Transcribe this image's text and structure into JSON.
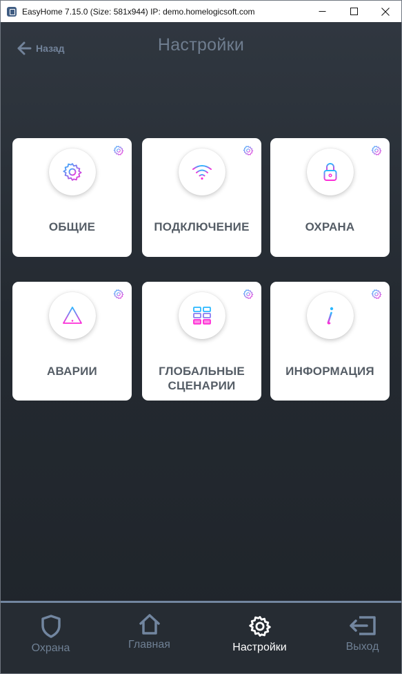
{
  "window": {
    "title": "EasyHome 7.15.0 (Size: 581x944) IP: demo.homelogicsoft.com"
  },
  "header": {
    "back_label": "Назад",
    "title": "Настройки"
  },
  "tiles": [
    {
      "label": "ОБЩИЕ",
      "icon": "gear-icon"
    },
    {
      "label": "ПОДКЛЮЧЕНИЕ",
      "icon": "wifi-icon"
    },
    {
      "label": "ОХРАНА",
      "icon": "lock-icon"
    },
    {
      "label": "АВАРИИ",
      "icon": "warning-icon"
    },
    {
      "label_line1": "ГЛОБАЛЬНЫЕ",
      "label_line2": "СЦЕНАРИИ",
      "icon": "grid-icon"
    },
    {
      "label": "ИНФОРМАЦИЯ",
      "icon": "info-icon"
    }
  ],
  "bottom_nav": [
    {
      "label": "Охрана",
      "icon": "shield-icon",
      "active": false
    },
    {
      "label": "Главная",
      "icon": "home-icon",
      "active": false
    },
    {
      "label": "Настройки",
      "icon": "gear-icon",
      "active": true
    },
    {
      "label": "Выход",
      "icon": "exit-icon",
      "active": false
    }
  ],
  "colors": {
    "accent_gradient_start": "#2ab8ff",
    "accent_gradient_end": "#ff2bd6",
    "background": "#2a3038",
    "tile_background": "#ffffff",
    "nav_inactive": "#6f8094",
    "nav_active": "#ffffff"
  }
}
